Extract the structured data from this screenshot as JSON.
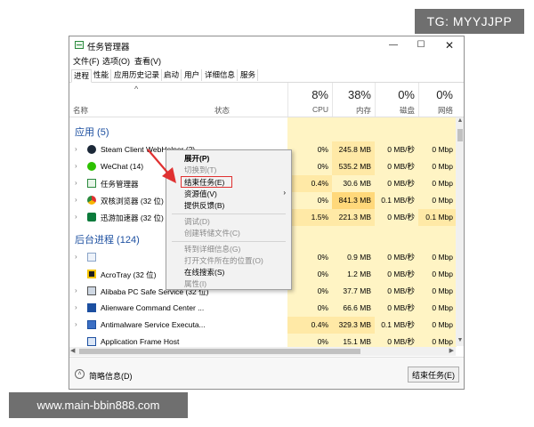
{
  "watermark_top": "TG: MYYJJPP",
  "watermark_bottom": "www.main-bbin888.com",
  "window": {
    "title": "任务管理器",
    "controls": [
      "—",
      "☐",
      "✕"
    ]
  },
  "menubar": [
    "文件(F)",
    "选项(O)",
    "查看(V)"
  ],
  "tabs": [
    "进程",
    "性能",
    "应用历史记录",
    "启动",
    "用户",
    "详细信息",
    "服务"
  ],
  "header": {
    "sort_arrow": "^",
    "name": "名称",
    "status": "状态",
    "columns": [
      {
        "pct": "8%",
        "label": "CPU"
      },
      {
        "pct": "38%",
        "label": "内存"
      },
      {
        "pct": "0%",
        "label": "磁盘"
      },
      {
        "pct": "0%",
        "label": "网络"
      }
    ]
  },
  "groups": {
    "apps": "应用 (5)",
    "background": "后台进程 (124)"
  },
  "app_rows": [
    {
      "name": "Steam Client WebHelper (2)",
      "icon": "steam-icon",
      "cpu": "0%",
      "mem": "245.8 MB",
      "disk": "0 MB/秒",
      "net": "0 Mbp"
    },
    {
      "name": "WeChat (14)",
      "icon": "wechat-icon",
      "cpu": "0%",
      "mem": "535.2 MB",
      "disk": "0 MB/秒",
      "net": "0 Mbp"
    },
    {
      "name": "任务管理器",
      "icon": "taskmgr-icon",
      "cpu": "0.4%",
      "mem": "30.6 MB",
      "disk": "0 MB/秒",
      "net": "0 Mbp"
    },
    {
      "name": "双核浏览器 (32 位) (",
      "icon": "browser-icon",
      "cpu": "0%",
      "mem": "841.3 MB",
      "disk": "0.1 MB/秒",
      "net": "0 Mbp"
    },
    {
      "name": "迅游加速器 (32 位) (",
      "icon": "xunyou-icon",
      "cpu": "1.5%",
      "mem": "221.3 MB",
      "disk": "0 MB/秒",
      "net": "0.1 Mbp"
    }
  ],
  "bg_rows": [
    {
      "name": "",
      "icon": "generic-process-icon",
      "cpu": "0%",
      "mem": "0.9 MB",
      "disk": "0 MB/秒",
      "net": "0 Mbp"
    },
    {
      "name": "AcroTray (32 位)",
      "icon": "acrotray-icon",
      "cpu": "0%",
      "mem": "1.2 MB",
      "disk": "0 MB/秒",
      "net": "0 Mbp"
    },
    {
      "name": "Alibaba PC Safe Service (32 位)",
      "icon": "alibaba-icon",
      "cpu": "0%",
      "mem": "37.7 MB",
      "disk": "0 MB/秒",
      "net": "0 Mbp"
    },
    {
      "name": "Alienware Command Center ...",
      "icon": "alienware-icon",
      "cpu": "0%",
      "mem": "66.6 MB",
      "disk": "0 MB/秒",
      "net": "0 Mbp"
    },
    {
      "name": "Antimalware Service Executa...",
      "icon": "antimalware-icon",
      "cpu": "0.4%",
      "mem": "329.3 MB",
      "disk": "0.1 MB/秒",
      "net": "0 Mbp"
    },
    {
      "name": "Application Frame Host",
      "icon": "appframe-icon",
      "cpu": "0%",
      "mem": "15.1 MB",
      "disk": "0 MB/秒",
      "net": "0 Mbp"
    }
  ],
  "footer": {
    "fewer_details": "简略信息(D)",
    "end_task": "结束任务(E)"
  },
  "context_menu": {
    "items": [
      {
        "label": "展开(P)",
        "state": "bold"
      },
      {
        "label": "切换到(T)",
        "state": "disabled"
      },
      {
        "label": "结束任务(E)",
        "state": "normal",
        "highlighted": true
      },
      {
        "label": "资源值(V)",
        "state": "normal",
        "submenu": true
      },
      {
        "label": "提供反馈(B)",
        "state": "normal"
      },
      {
        "label": "调试(D)",
        "state": "disabled"
      },
      {
        "label": "创建转储文件(C)",
        "state": "disabled"
      },
      {
        "label": "转到详细信息(G)",
        "state": "disabled"
      },
      {
        "label": "打开文件所在的位置(O)",
        "state": "disabled"
      },
      {
        "label": "在线搜索(S)",
        "state": "normal"
      },
      {
        "label": "属性(I)",
        "state": "disabled"
      }
    ],
    "submenu_arrow": "›"
  },
  "colors": {
    "accent_blue": "#1c4fa0",
    "heat_light": "#fff4c4",
    "heat_mid": "#ffe9a6",
    "heat_dark": "#ffd87a",
    "annotation_red": "#e03131"
  }
}
